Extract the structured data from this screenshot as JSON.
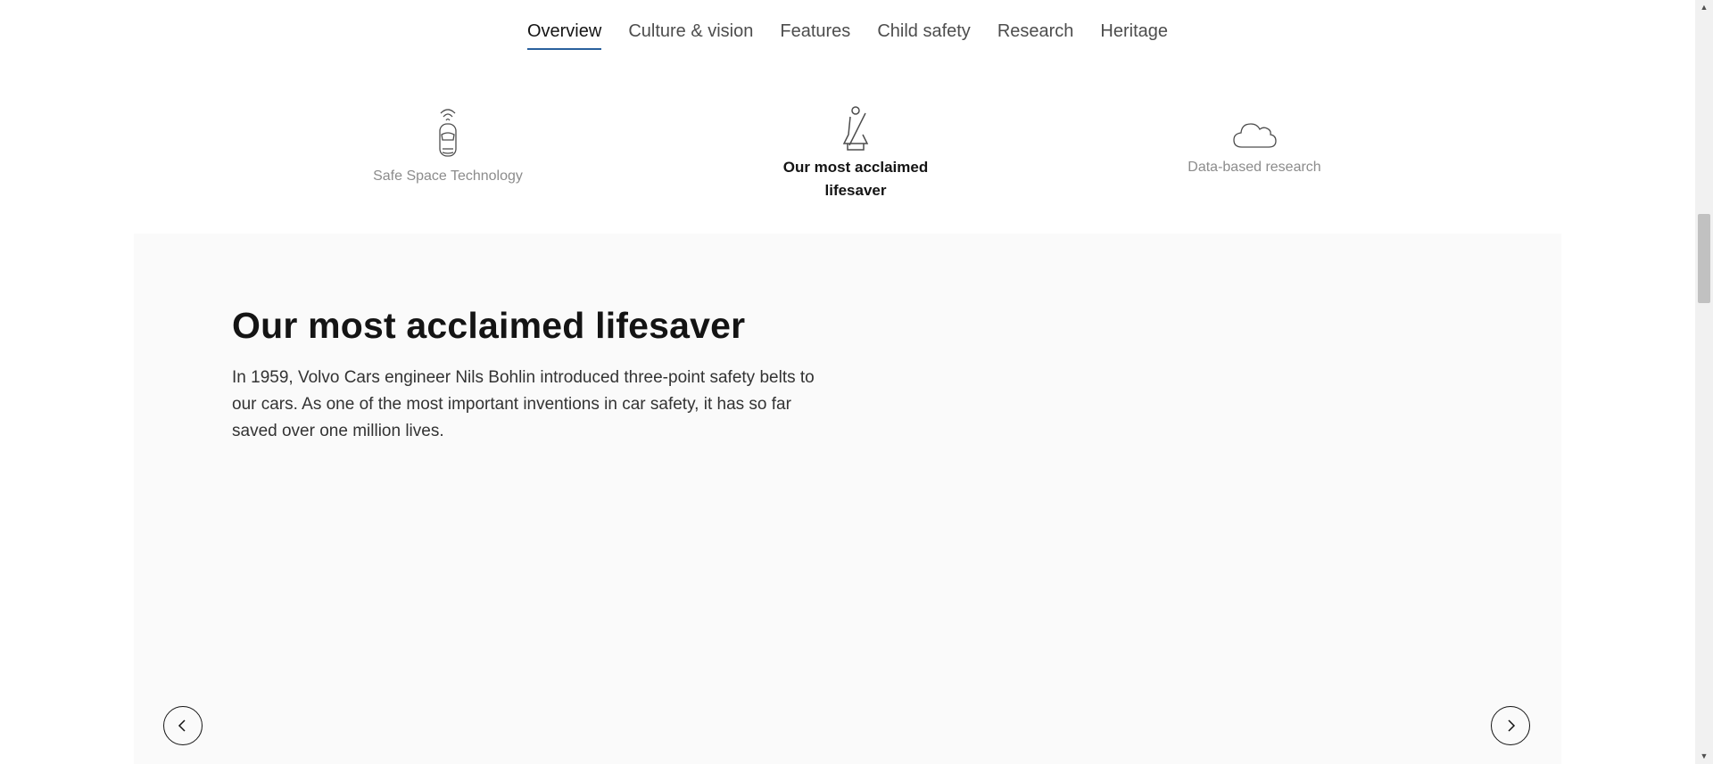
{
  "tabs": [
    {
      "label": "Overview",
      "active": true
    },
    {
      "label": "Culture & vision",
      "active": false
    },
    {
      "label": "Features",
      "active": false
    },
    {
      "label": "Child safety",
      "active": false
    },
    {
      "label": "Research",
      "active": false
    },
    {
      "label": "Heritage",
      "active": false
    }
  ],
  "features": [
    {
      "label": "Safe Space Technology",
      "icon": "car-sensor-icon",
      "active": false
    },
    {
      "label": "Our most acclaimed lifesaver",
      "icon": "seatbelt-person-icon",
      "active": true
    },
    {
      "label": "Data-based research",
      "icon": "cloud-icon",
      "active": false
    }
  ],
  "content": {
    "title": "Our most acclaimed lifesaver",
    "body": "In 1959, Volvo Cars engineer Nils Bohlin introduced three-point safety belts to our cars. As one of the most important inventions in car safety, it has so far saved over one million lives."
  },
  "carousel": {
    "prev_icon": "chevron-left-icon",
    "next_icon": "chevron-right-icon"
  },
  "colors": {
    "accent_underline": "#2a609d",
    "panel_bg": "#fafafa",
    "text_primary": "#141414",
    "text_muted": "#8c8c8c"
  }
}
